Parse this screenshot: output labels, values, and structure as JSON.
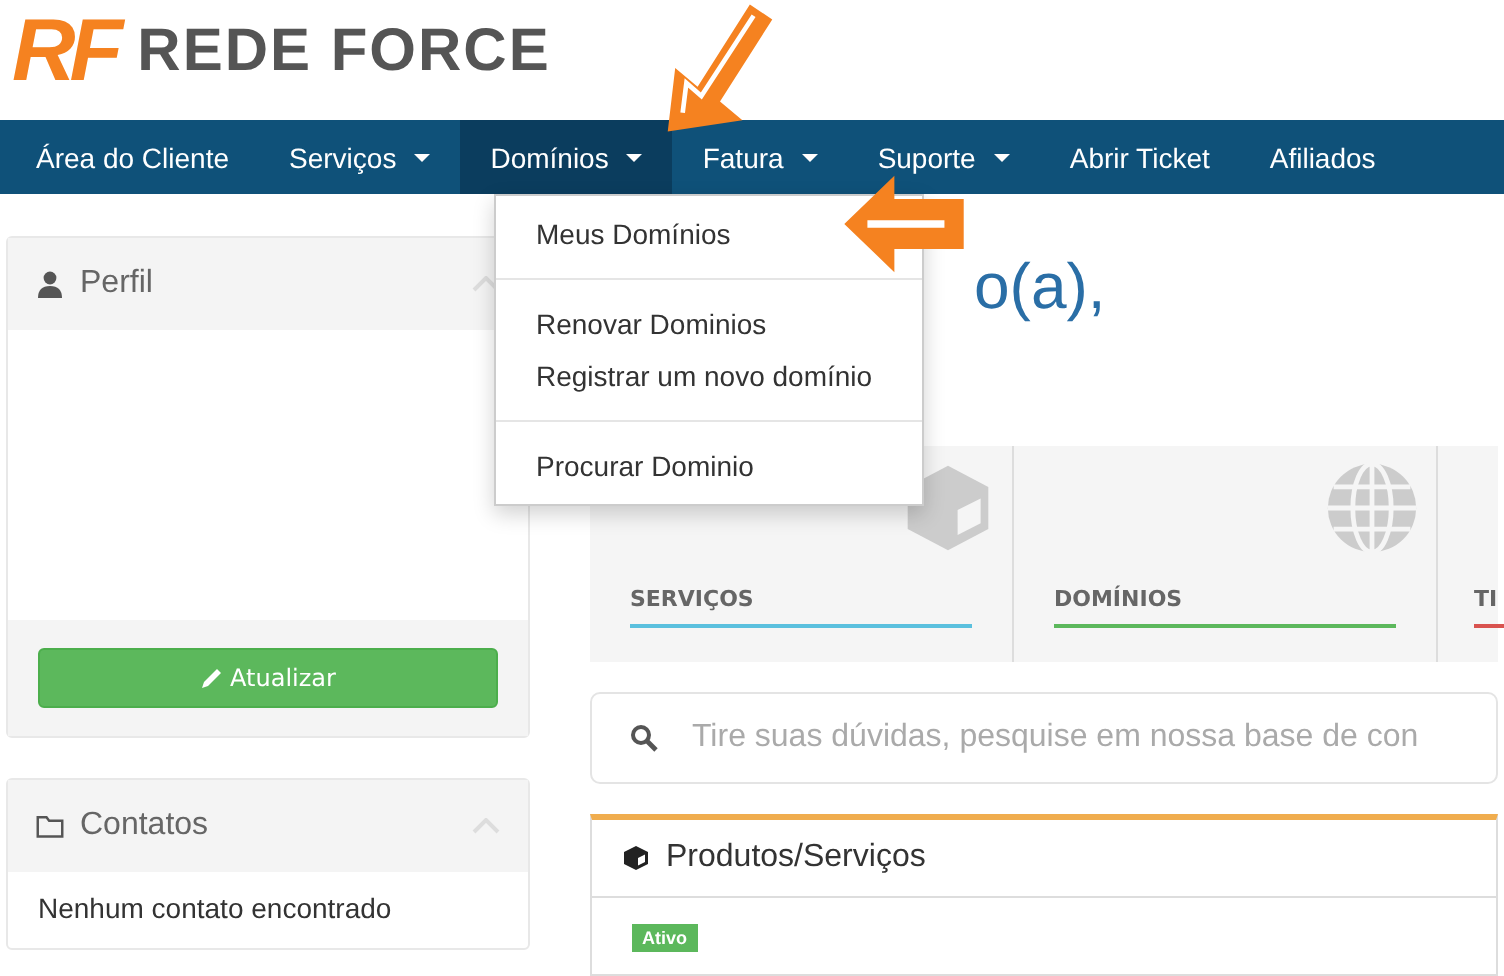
{
  "logo": {
    "mark": "RF",
    "name": "REDE FORCE"
  },
  "nav": [
    {
      "label": "Área do Cliente",
      "dropdown": false,
      "selected": false
    },
    {
      "label": "Serviços",
      "dropdown": true,
      "selected": false
    },
    {
      "label": "Domínios",
      "dropdown": true,
      "selected": true
    },
    {
      "label": "Fatura",
      "dropdown": true,
      "selected": false
    },
    {
      "label": "Suporte",
      "dropdown": true,
      "selected": false
    },
    {
      "label": "Abrir Ticket",
      "dropdown": false,
      "selected": false
    },
    {
      "label": "Afiliados",
      "dropdown": false,
      "selected": false
    }
  ],
  "dropdown_menu": {
    "groups": [
      [
        "Meus Domínios"
      ],
      [
        "Renovar Dominios",
        "Registrar um novo domínio"
      ],
      [
        "Procurar Dominio"
      ]
    ]
  },
  "sidebar": [
    {
      "kind": "profile",
      "title": "Perfil",
      "button": "Atualizar"
    },
    {
      "kind": "contacts",
      "title": "Contatos",
      "text": "Nenhum contato encontrado"
    }
  ],
  "greeting": "o(a),",
  "stats": [
    {
      "label": "SERVIÇOS",
      "color": "#5bc0de"
    },
    {
      "label": "DOMÍNIOS",
      "color": "#5cb85c"
    },
    {
      "label": "TI",
      "color": "#d9534f"
    }
  ],
  "search": {
    "placeholder": "Tire suas dúvidas, pesquise em nossa base de con"
  },
  "products": {
    "title": "Produtos/Serviços",
    "badge": {
      "label": "Ativo",
      "color": "#5cb85c"
    }
  }
}
